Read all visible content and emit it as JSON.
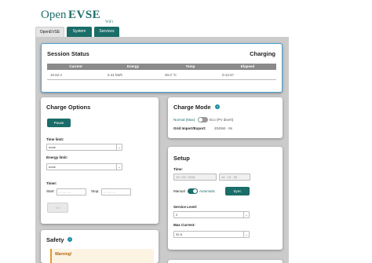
{
  "logo": {
    "open": "Open",
    "evse": "EVSE",
    "wifi": "WiFi"
  },
  "tabs": [
    {
      "label": "OpenEVSE"
    },
    {
      "label": "System"
    },
    {
      "label": "Services"
    }
  ],
  "status": {
    "title": "Session Status",
    "state": "Charging",
    "columns": [
      "Current",
      "Energy",
      "Temp",
      "Elapsed"
    ],
    "values": [
      "10.62 A",
      "0.41 kWh",
      "30.0 °C",
      "0:13:47"
    ]
  },
  "options": {
    "title": "Charge Options",
    "pause_label": "Pause",
    "time_limit_label": "Time limit:",
    "time_limit_value": "none",
    "energy_limit_label": "Energy limit:",
    "energy_limit_value": "none",
    "timer_label": "Timer:",
    "start_label": "Start:",
    "start_placeholder": "-- : -- : --",
    "stop_label": "Stop:",
    "stop_placeholder": "-- : -- : --",
    "save_label": "Set"
  },
  "mode": {
    "title": "Charge Mode",
    "info_icon": "i",
    "normal_label": "Normal (Max)",
    "eco_label": "Eco (PV divert)",
    "grid_label": "Grid Import/Export:",
    "grid_value": "2045W - 9s"
  },
  "setup": {
    "title": "Setup",
    "time_label": "Time:",
    "date_value": "19 / 03 / 2019",
    "time_value": "12 : 13 : 33",
    "manual_label": "Manual",
    "automatic_label": "Automatic",
    "sync_label": "Sync",
    "service_level_label": "Service Level:",
    "service_level_value": "2",
    "max_current_label": "Max Current:",
    "max_current_value": "32 A"
  },
  "safety": {
    "title": "Safety",
    "info_icon": "i",
    "warning": "Warning!"
  },
  "colors": {
    "accent": "#1a6d68",
    "status_border": "#4aa6d8",
    "warning": "#e09a2d"
  }
}
